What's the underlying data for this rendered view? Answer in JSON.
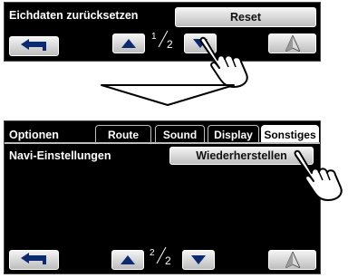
{
  "top_screen": {
    "title": "Eichdaten zurücksetzen",
    "reset_label": "Reset",
    "page_current": "1",
    "page_total": "2"
  },
  "bottom_screen": {
    "options_label": "Optionen",
    "tabs": [
      {
        "label": "Route"
      },
      {
        "label": "Sound"
      },
      {
        "label": "Display"
      },
      {
        "label": "Sonstiges"
      }
    ],
    "section_title": "Navi-Einstellungen",
    "restore_label": "Wiederherstellen",
    "page_current": "2",
    "page_total": "2"
  },
  "icons": {
    "back": "back-arrow-icon",
    "up": "triangle-up-icon",
    "down": "triangle-down-icon",
    "navigation": "navigation-arrow-icon",
    "pointer": "hand-pointer-icon"
  }
}
